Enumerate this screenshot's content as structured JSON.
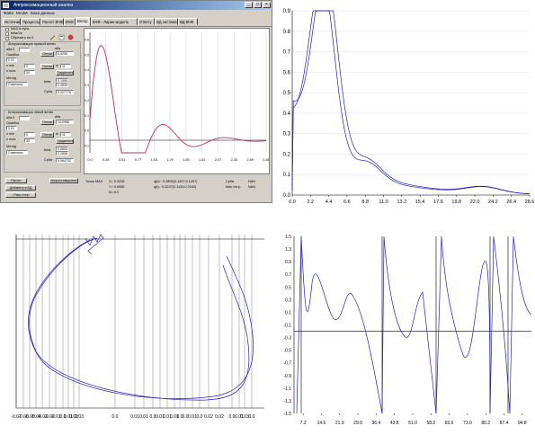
{
  "window": {
    "title": "Аппроксимационный анализ",
    "menu": [
      "Файл",
      "МАЗИ",
      "База данных"
    ],
    "tabs": [
      "Источник",
      "Процессы",
      "Расчет ВЧФ",
      "ВЧФ",
      "Ветер",
      "ВЧФ - Ларин модель",
      "Ответу",
      "ВД система",
      "ВД ВЧФ"
    ],
    "active_tab": "Ветер",
    "checkboxes": [
      {
        "label": "MAX в нуль",
        "checked": true
      },
      {
        "label": "beta/2a",
        "checked": true
      },
      {
        "label": "Обрезать на 0",
        "checked": false
      }
    ],
    "section1": {
      "title": "Аппроксимация прямой ветви",
      "alfa0_label": "alfa 0",
      "error_label": "Ошибка",
      "error_value": "0.01",
      "alfa_label": "alfa",
      "alfa_value": "6.4255",
      "optim_label": "Оптим",
      "nmin_label": "n min",
      "nmin_value": "0",
      "nmax_label": "n max",
      "nmax_value": "30",
      "m_label": "m",
      "m_value": "11",
      "optim2_label": "Оптим",
      "gradient_label": "Градиентный",
      "method_label": "Метод",
      "method_value": "Симплекс",
      "beta_label": "beta",
      "beta_values": [
        "0.1955",
        "0.4539"
      ],
      "skn_label": "СрКв",
      "skn_value": "0.027775"
    },
    "section2": {
      "title": "Аппроксимация левой ветви",
      "alfa0_label": "alfa 0",
      "error_label": "Ошибка",
      "error_value": "0.01",
      "alfa_label": "alfa",
      "alfa_value": "10.0966",
      "optim_label": "Оптим",
      "nmin_label": "n min",
      "nmin_value": "0",
      "nmax_label": "n max",
      "nmax_value": "30",
      "m_label": "m",
      "m_value": "11",
      "optim2_label": "Оптим",
      "gradient_label": "Градиентный",
      "method_label": "Метод",
      "method_value": "Симплекс",
      "beta_label": "beta",
      "beta_values": [
        "0.0604",
        "0.2858"
      ],
      "skn_label": "СрКв",
      "skn_value": "0.064732"
    },
    "buttons": {
      "calc": "Расчет",
      "approx": "Аппроксимировать",
      "add_db": "Добавить в БД",
      "reset": "<Твер попр"
    },
    "info": {
      "point_max": "Точка MAX",
      "x": "X= 0.2228",
      "y": "Y= 0.6985",
      "n": "N= 6.0",
      "qp": "q(t)+: 0.2895(0.1397;0.1497)",
      "qm": "q(t)-: 0.3237(0.1134;0.2162)",
      "skn_label": "СрКв",
      "skn_value": "NAN",
      "max_label": "Max погр.",
      "max_value": "NAN"
    },
    "plot": {
      "y_ticks": [
        "0.6",
        "0.5",
        "0.4",
        "0.3",
        "0.2",
        "0.1",
        "0.0",
        "-0.1"
      ],
      "x_ticks": [
        "0.0",
        "0.25",
        "0.51",
        "0.77",
        "1.03",
        "1.29",
        "1.55",
        "1.81",
        "2.07",
        "2.33",
        "2.59",
        "2.85"
      ]
    }
  },
  "charts": {
    "top_right": {
      "y_ticks": [
        "0.9",
        "0.8",
        "0.7",
        "0.6",
        "0.5",
        "0.4",
        "0.3",
        "0.2",
        "0.1",
        "0.0"
      ],
      "x_ticks": [
        "0.0",
        "2.2",
        "4.4",
        "6.6",
        "8.8",
        "11.0",
        "13.2",
        "15.4",
        "17.6",
        "19.8",
        "22.0",
        "24.2",
        "26.4",
        "28.6"
      ],
      "line_color": "#2222bb"
    },
    "bottom_left": {
      "x_ticks": [
        "-0.07",
        "-0.06",
        "-0.05",
        "-0.04",
        "-0.03",
        "-0.02",
        "-0.01",
        "0.0",
        "0.01",
        "0.02",
        "0.03",
        "0.0",
        "0.01",
        "0.01",
        "0.0",
        "0.01",
        "0.01",
        "0.01",
        "0.0",
        "0.0",
        "0.01",
        "0.0",
        "0.02",
        "0.02",
        "0.0",
        "0.01",
        "0.03",
        "0.0"
      ],
      "line_color": "#2222bb"
    },
    "bottom_right": {
      "y_ticks": [
        "1.5",
        "1.3",
        "0.9",
        "0.7",
        "0.5",
        "0.3",
        "0.1",
        "-0.1",
        "-0.3",
        "-0.5",
        "-0.7",
        "-0.9",
        "-1.1",
        "-1.3",
        "-1.5"
      ],
      "x_ticks": [
        "7.2",
        "14.6",
        "21.9",
        "29.0",
        "36.4",
        "43.8",
        "51.0",
        "58.2",
        "65.6",
        "73.0",
        "80.2",
        "87.4",
        "94.8"
      ],
      "line_color": "#2222bb"
    }
  }
}
